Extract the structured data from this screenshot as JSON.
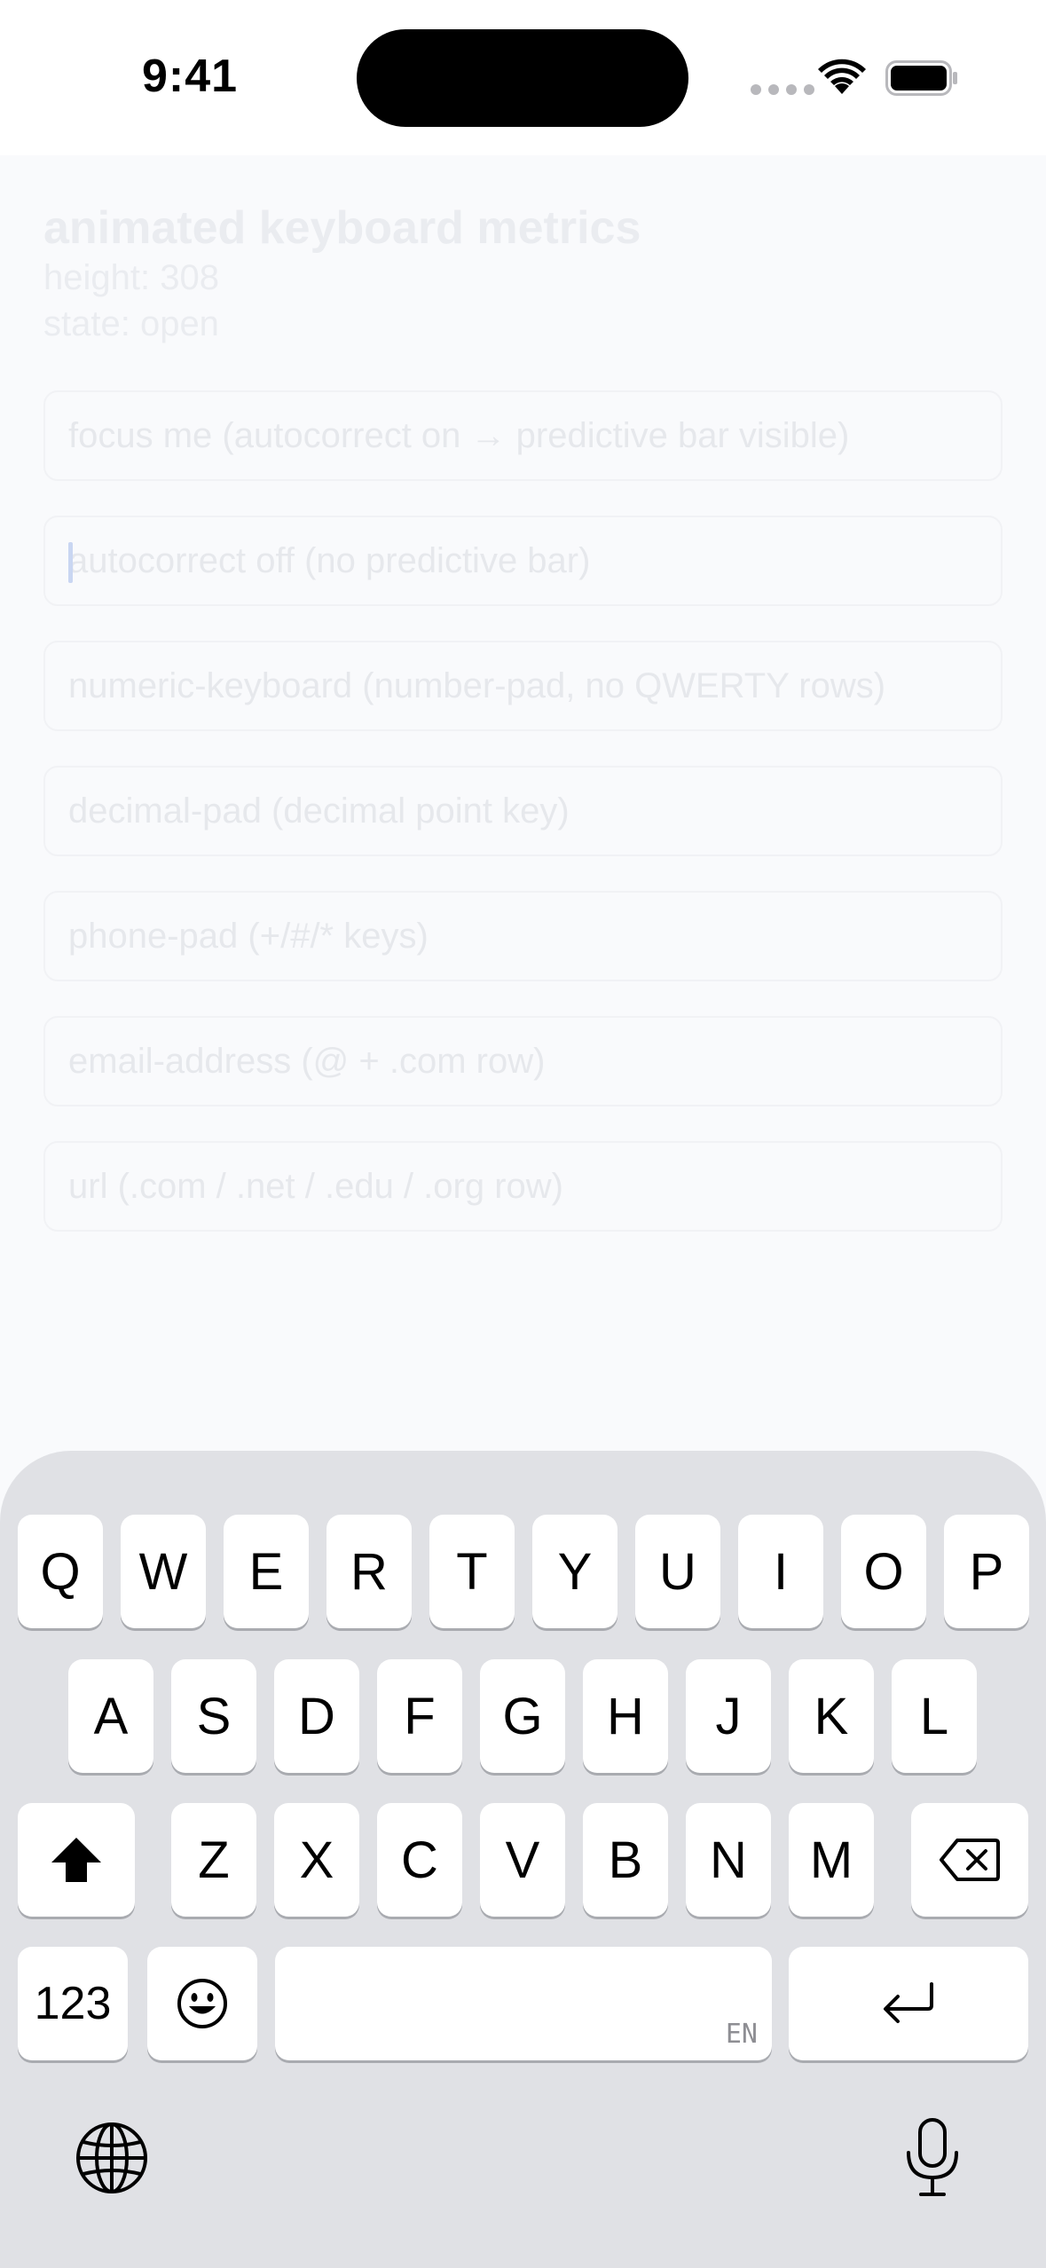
{
  "status_bar": {
    "time": "9:41"
  },
  "page": {
    "title": "animated keyboard metrics",
    "height_line": "height: 308",
    "state_line": "state: open"
  },
  "fields": [
    {
      "name": "autocorrect-on-field",
      "placeholder": "focus me (autocorrect on → predictive bar visible)"
    },
    {
      "name": "autocorrect-off-field",
      "placeholder": "autocorrect off (no predictive bar)"
    },
    {
      "name": "numeric-keyboard-field",
      "placeholder": "numeric-keyboard (number-pad, no QWERTY rows)"
    },
    {
      "name": "decimal-pad-field",
      "placeholder": "decimal-pad (decimal point key)"
    },
    {
      "name": "phone-pad-field",
      "placeholder": "phone-pad (+/#/* keys)"
    },
    {
      "name": "email-address-field",
      "placeholder": "email-address (@ + .com row)"
    },
    {
      "name": "url-field",
      "placeholder": "url (.com / .net / .edu / .org row)"
    }
  ],
  "keyboard": {
    "row1": [
      "Q",
      "W",
      "E",
      "R",
      "T",
      "Y",
      "U",
      "I",
      "O",
      "P"
    ],
    "row2": [
      "A",
      "S",
      "D",
      "F",
      "G",
      "H",
      "J",
      "K",
      "L"
    ],
    "row3": [
      "Z",
      "X",
      "C",
      "V",
      "B",
      "N",
      "M"
    ],
    "numbers_label": "123",
    "space_language": "EN",
    "icons": {
      "shift": "shift-icon",
      "delete": "delete-icon",
      "emoji": "emoji-icon",
      "return": "return-icon",
      "globe": "globe-icon",
      "mic": "microphone-icon"
    }
  }
}
